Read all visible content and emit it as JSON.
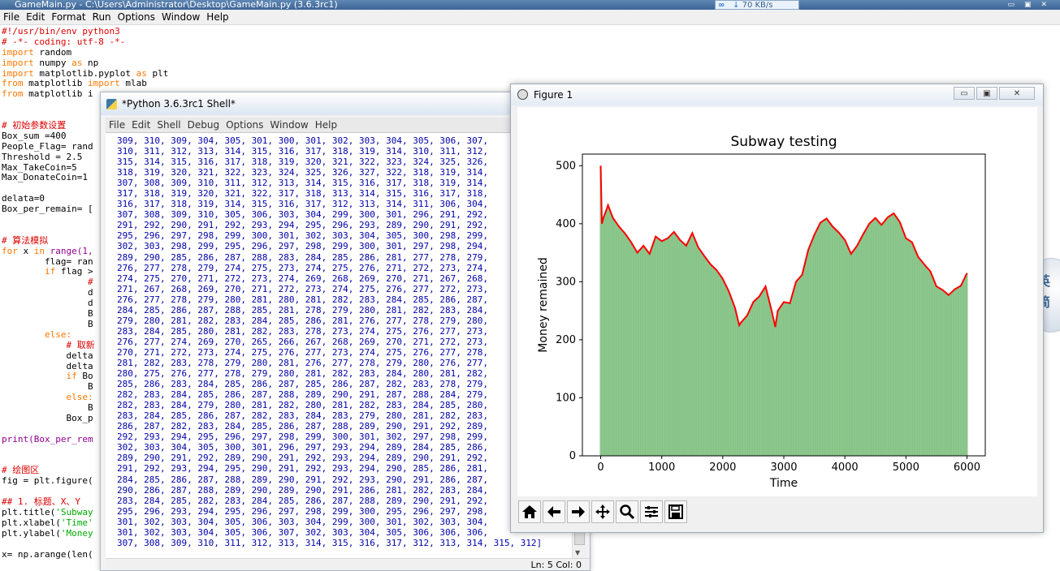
{
  "editor": {
    "title": "GameMain.py - C:\\Users\\Administrator\\Desktop\\GameMain.py (3.6.3rc1)",
    "menu": [
      "File",
      "Edit",
      "Format",
      "Run",
      "Options",
      "Window",
      "Help"
    ],
    "code_lines": [
      "#!/usr/bin/env python3",
      "# -*- coding: utf-8 -*-",
      "import random",
      "import numpy as np",
      "import matplotlib.pyplot as plt",
      "from matplotlib import mlab",
      "from matplotlib i",
      "",
      "",
      "# 初始参数设置",
      "Box_sum =400",
      "People_Flag= rand",
      "Threshold = 2.5",
      "Max_TakeCoin=5",
      "Max_DonateCoin=1",
      "",
      "delata=0",
      "Box_per_remain= [",
      "",
      "",
      "# 算法模拟",
      "for x in range(1,",
      "        flag= ran",
      "        if flag >",
      "                #",
      "                d",
      "                d",
      "                B",
      "                B",
      "        else:",
      "            # 取新",
      "            delta",
      "            delta",
      "            if Bo",
      "                B",
      "            else:",
      "                B",
      "            Box_p",
      "",
      "print(Box_per_rem",
      "",
      "",
      "# 绘图区",
      "fig = plt.figure(",
      "",
      "## 1. 标题、X、Y",
      "plt.title('Subway",
      "plt.xlabel('Time'",
      "plt.ylabel('Money",
      "",
      "x= np.arange(len("
    ],
    "network_speed": "70 KB/s"
  },
  "shell": {
    "title": "*Python 3.6.3rc1 Shell*",
    "menu": [
      "File",
      "Edit",
      "Shell",
      "Debug",
      "Options",
      "Window",
      "Help"
    ],
    "output": "309, 310, 309, 304, 305, 301, 300, 301, 302, 303, 304, 305, 306, 307,\n310, 311, 312, 313, 314, 315, 316, 317, 318, 319, 314, 310, 311, 312,\n315, 314, 315, 316, 317, 318, 319, 320, 321, 322, 323, 324, 325, 326,\n318, 319, 320, 321, 322, 323, 324, 325, 326, 327, 322, 318, 319, 314,\n307, 308, 309, 310, 311, 312, 313, 314, 315, 316, 317, 318, 319, 314,\n317, 318, 319, 320, 321, 322, 317, 318, 313, 314, 315, 316, 317, 318,\n316, 317, 318, 319, 314, 315, 316, 317, 312, 313, 314, 311, 306, 304,\n307, 308, 309, 310, 305, 306, 303, 304, 299, 300, 301, 296, 291, 292,\n291, 292, 290, 291, 292, 293, 294, 295, 296, 293, 289, 290, 291, 292,\n295, 296, 297, 298, 299, 300, 301, 302, 303, 304, 305, 300, 298, 299,\n302, 303, 298, 299, 295, 296, 297, 298, 299, 300, 301, 297, 298, 294,\n289, 290, 285, 286, 287, 288, 283, 284, 285, 286, 281, 277, 278, 279,\n276, 277, 278, 279, 274, 275, 273, 274, 275, 276, 271, 272, 273, 274,\n274, 275, 270, 271, 272, 273, 274, 269, 268, 269, 270, 271, 267, 268,\n271, 267, 268, 269, 270, 271, 272, 273, 274, 275, 276, 277, 272, 273,\n276, 277, 278, 279, 280, 281, 280, 281, 282, 283, 284, 285, 286, 287,\n284, 285, 286, 287, 288, 285, 281, 278, 279, 280, 281, 282, 283, 284,\n279, 280, 281, 282, 283, 284, 285, 286, 281, 276, 277, 278, 279, 280,\n283, 284, 285, 280, 281, 282, 283, 278, 273, 274, 275, 276, 277, 273,\n276, 277, 274, 269, 270, 265, 266, 267, 268, 269, 270, 271, 272, 273,\n270, 271, 272, 273, 274, 275, 276, 277, 273, 274, 275, 276, 277, 278,\n281, 282, 283, 278, 279, 280, 281, 276, 277, 278, 279, 280, 276, 277,\n280, 275, 276, 277, 278, 279, 280, 281, 282, 283, 284, 280, 281, 282,\n285, 286, 283, 284, 285, 286, 287, 285, 286, 287, 282, 283, 278, 279,\n282, 283, 284, 285, 286, 287, 288, 289, 290, 291, 287, 288, 284, 279,\n282, 283, 284, 279, 280, 281, 282, 280, 281, 282, 283, 284, 285, 280,\n283, 284, 285, 286, 287, 282, 283, 284, 283, 279, 280, 281, 282, 283,\n286, 287, 282, 283, 284, 285, 286, 287, 288, 289, 290, 291, 292, 289,\n292, 293, 294, 295, 296, 297, 298, 299, 300, 301, 302, 297, 298, 299,\n302, 303, 304, 305, 300, 301, 296, 297, 293, 294, 289, 284, 285, 286,\n289, 290, 291, 292, 289, 290, 291, 292, 293, 294, 289, 290, 291, 292,\n291, 292, 293, 294, 295, 290, 291, 292, 293, 294, 290, 285, 286, 281,\n284, 285, 286, 287, 288, 289, 290, 291, 292, 293, 290, 291, 286, 287,\n290, 286, 287, 288, 289, 290, 289, 290, 291, 286, 281, 282, 283, 284,\n283, 284, 285, 282, 283, 284, 285, 286, 287, 288, 289, 290, 291, 292,\n295, 296, 293, 294, 295, 296, 297, 298, 299, 300, 295, 296, 297, 298,\n301, 302, 303, 304, 305, 306, 303, 304, 299, 300, 301, 302, 303, 304,\n301, 302, 303, 304, 305, 306, 307, 302, 303, 304, 305, 306, 306, 306,\n307, 308, 309, 310, 311, 312, 313, 314, 315, 316, 317, 312, 313, 314, 315, 312]",
    "status": "Ln: 5   Col: 0"
  },
  "figure": {
    "title": "Figure 1",
    "buttons": {
      "minimize": "▭",
      "maximize": "▣",
      "close": "✕"
    },
    "toolbar": [
      "home-icon",
      "back-arrow-icon",
      "forward-arrow-icon",
      "pan-move-icon",
      "zoom-magnifier-icon",
      "configure-subplots-icon",
      "save-floppy-icon"
    ]
  },
  "chart_data": {
    "type": "bar",
    "title": "Subway testing",
    "xlabel": "Time",
    "ylabel": "Money remained",
    "xlim": [
      -300,
      6300
    ],
    "ylim": [
      0,
      520
    ],
    "xticks": [
      0,
      1000,
      2000,
      3000,
      4000,
      5000,
      6000
    ],
    "yticks": [
      0,
      100,
      200,
      300,
      400,
      500
    ],
    "bar_color": "#7fbf7f",
    "line_color": "#ff0000",
    "series": [
      {
        "x": [
          0,
          20,
          50,
          80,
          120,
          200,
          300,
          400,
          500,
          600,
          700,
          800,
          900,
          1000,
          1100,
          1200,
          1300,
          1400,
          1500,
          1600,
          1700,
          1800,
          1900,
          2000,
          2100,
          2200,
          2270,
          2300,
          2400,
          2500,
          2600,
          2700,
          2800,
          2860,
          2900,
          3000,
          3100,
          3200,
          3300,
          3400,
          3500,
          3600,
          3700,
          3800,
          3900,
          4000,
          4100,
          4200,
          4300,
          4400,
          4500,
          4600,
          4700,
          4800,
          4900,
          5000,
          5100,
          5200,
          5300,
          5400,
          5500,
          5600,
          5700,
          5800,
          5900,
          6000
        ],
        "values": [
          500,
          400,
          412,
          420,
          432,
          410,
          395,
          383,
          368,
          350,
          362,
          348,
          378,
          370,
          375,
          386,
          372,
          362,
          384,
          359,
          344,
          330,
          320,
          305,
          283,
          255,
          225,
          230,
          242,
          265,
          275,
          292,
          250,
          222,
          250,
          265,
          263,
          300,
          312,
          355,
          381,
          402,
          409,
          395,
          385,
          372,
          348,
          362,
          382,
          400,
          410,
          398,
          411,
          418,
          403,
          375,
          368,
          343,
          330,
          318,
          292,
          286,
          277,
          287,
          293,
          315
        ]
      }
    ]
  }
}
